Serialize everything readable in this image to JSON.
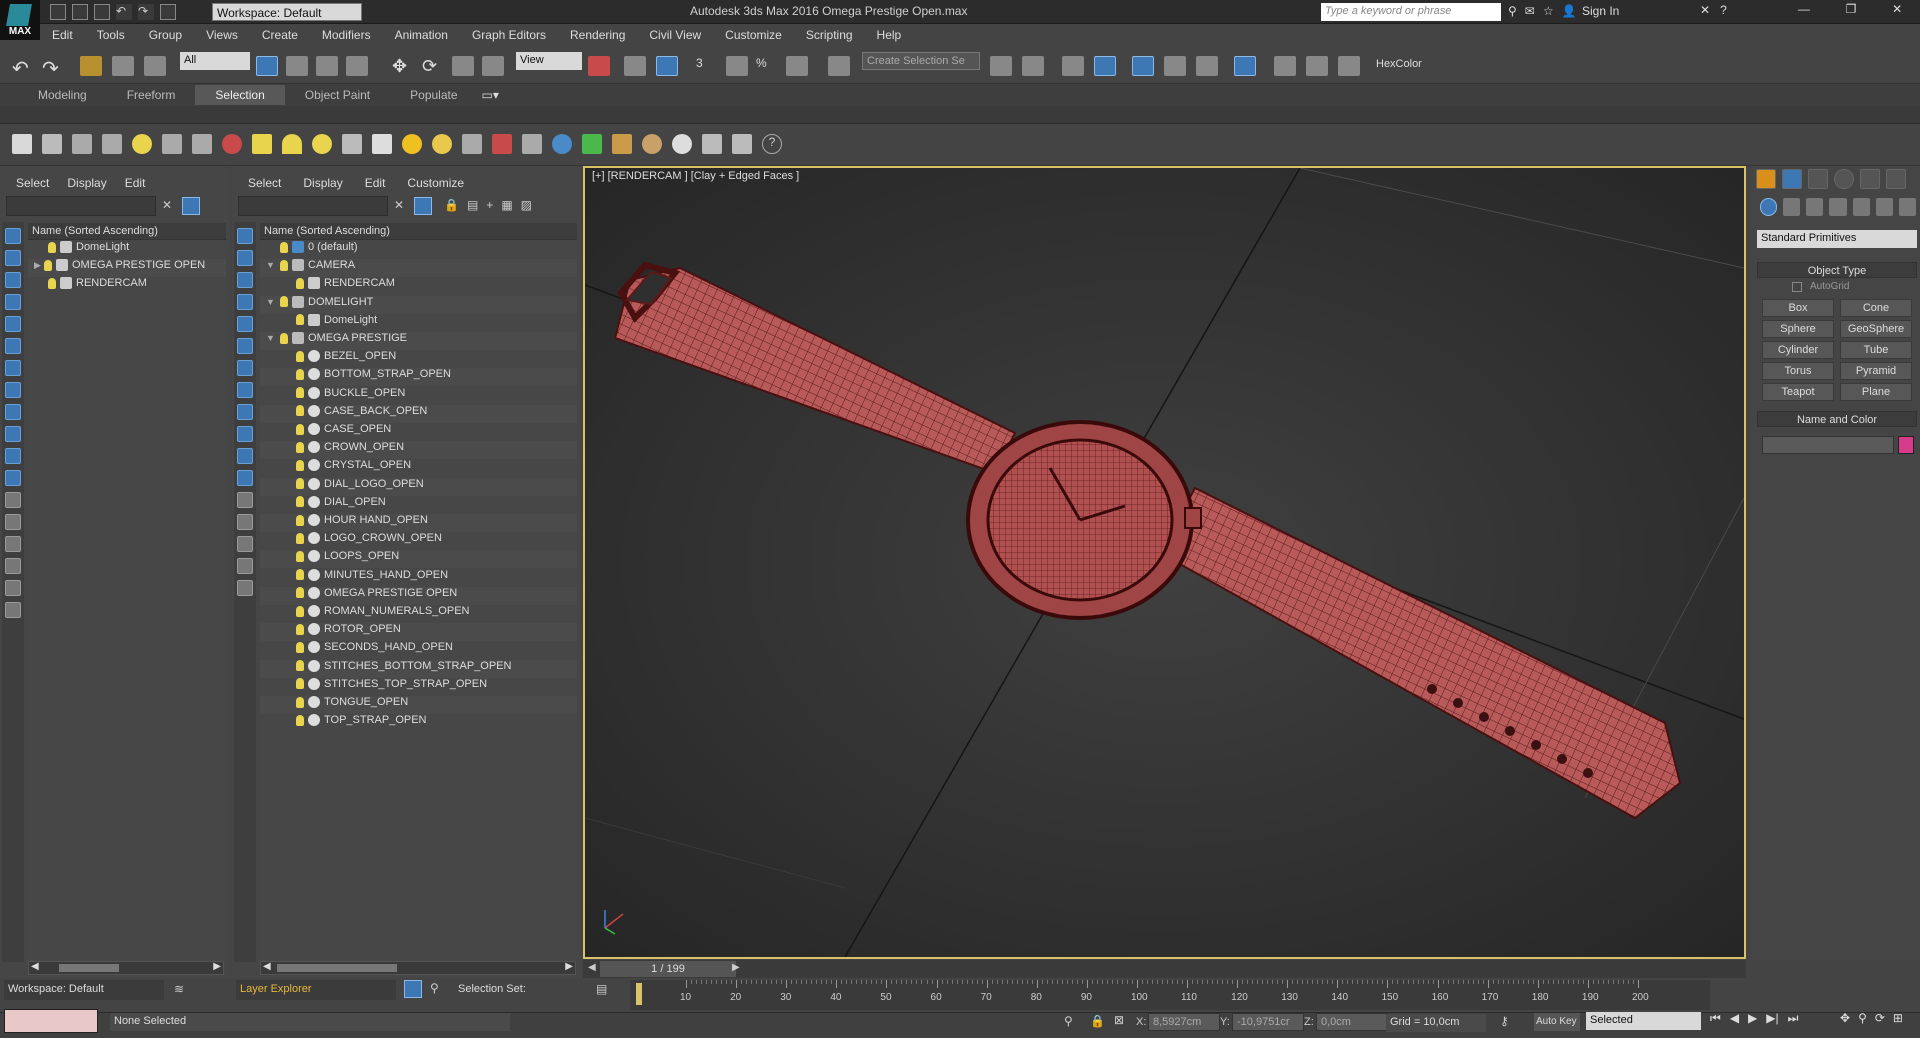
{
  "title_bar": {
    "workspace": "Workspace: Default",
    "app_title": "Autodesk 3ds Max 2016    Omega Prestige Open.max",
    "search_placeholder": "Type a keyword or phrase",
    "sign_in": "Sign In",
    "logo_text": "MAX"
  },
  "menu": [
    "Edit",
    "Tools",
    "Group",
    "Views",
    "Create",
    "Modifiers",
    "Animation",
    "Graph Editors",
    "Rendering",
    "Civil View",
    "Customize",
    "Scripting",
    "Help"
  ],
  "toolbar": {
    "filter_select": "All",
    "ref_coord": "View",
    "selection_set": "Create Selection Se",
    "hexcolor": "HexColor"
  },
  "ribbon_tabs": [
    "Modeling",
    "Freeform",
    "Selection",
    "Object Paint",
    "Populate"
  ],
  "ribbon_active": "Selection",
  "scene_explorer_left": {
    "menu": [
      "Select",
      "Display",
      "Edit"
    ],
    "header": "Name (Sorted Ascending)",
    "rows": [
      "DomeLight",
      "OMEGA PRESTIGE OPEN",
      "RENDERCAM"
    ]
  },
  "layer_explorer": {
    "menu": [
      "Select",
      "Display",
      "Edit",
      "Customize"
    ],
    "header": "Name (Sorted Ascending)",
    "rows": [
      {
        "label": "0 (default)",
        "indent": 1,
        "kind": "layer"
      },
      {
        "label": "CAMERA",
        "indent": 1,
        "kind": "layer"
      },
      {
        "label": "RENDERCAM",
        "indent": 2,
        "kind": "cam"
      },
      {
        "label": "DOMELIGHT",
        "indent": 1,
        "kind": "layer"
      },
      {
        "label": "DomeLight",
        "indent": 2,
        "kind": "light"
      },
      {
        "label": "OMEGA PRESTIGE",
        "indent": 1,
        "kind": "layer"
      },
      {
        "label": "BEZEL_OPEN",
        "indent": 2,
        "kind": "obj"
      },
      {
        "label": "BOTTOM_STRAP_OPEN",
        "indent": 2,
        "kind": "obj"
      },
      {
        "label": "BUCKLE_OPEN",
        "indent": 2,
        "kind": "obj"
      },
      {
        "label": "CASE_BACK_OPEN",
        "indent": 2,
        "kind": "obj"
      },
      {
        "label": "CASE_OPEN",
        "indent": 2,
        "kind": "obj"
      },
      {
        "label": "CROWN_OPEN",
        "indent": 2,
        "kind": "obj"
      },
      {
        "label": "CRYSTAL_OPEN",
        "indent": 2,
        "kind": "obj"
      },
      {
        "label": "DIAL_LOGO_OPEN",
        "indent": 2,
        "kind": "obj"
      },
      {
        "label": "DIAL_OPEN",
        "indent": 2,
        "kind": "obj"
      },
      {
        "label": "HOUR HAND_OPEN",
        "indent": 2,
        "kind": "obj"
      },
      {
        "label": "LOGO_CROWN_OPEN",
        "indent": 2,
        "kind": "obj"
      },
      {
        "label": "LOOPS_OPEN",
        "indent": 2,
        "kind": "obj"
      },
      {
        "label": "MINUTES_HAND_OPEN",
        "indent": 2,
        "kind": "obj"
      },
      {
        "label": "OMEGA PRESTIGE OPEN",
        "indent": 2,
        "kind": "obj"
      },
      {
        "label": "ROMAN_NUMERALS_OPEN",
        "indent": 2,
        "kind": "obj"
      },
      {
        "label": "ROTOR_OPEN",
        "indent": 2,
        "kind": "obj"
      },
      {
        "label": "SECONDS_HAND_OPEN",
        "indent": 2,
        "kind": "obj"
      },
      {
        "label": "STITCHES_BOTTOM_STRAP_OPEN",
        "indent": 2,
        "kind": "obj"
      },
      {
        "label": "STITCHES_TOP_STRAP_OPEN",
        "indent": 2,
        "kind": "obj"
      },
      {
        "label": "TONGUE_OPEN",
        "indent": 2,
        "kind": "obj"
      },
      {
        "label": "TOP_STRAP_OPEN",
        "indent": 2,
        "kind": "obj"
      }
    ]
  },
  "viewport": {
    "label": "[+] [RENDERCAM ] [Clay + Edged Faces ]"
  },
  "command_panel": {
    "category": "Standard Primitives",
    "object_type_header": "Object Type",
    "autogrid": "AutoGrid",
    "buttons": [
      "Box",
      "Cone",
      "Sphere",
      "GeoSphere",
      "Cylinder",
      "Tube",
      "Torus",
      "Pyramid",
      "Teapot",
      "Plane"
    ],
    "name_color_header": "Name and Color",
    "object_color": "#d83a8a"
  },
  "timeline": {
    "frame": "1 / 199",
    "ticks": [
      "10",
      "20",
      "30",
      "40",
      "50",
      "60",
      "70",
      "80",
      "90",
      "100",
      "110",
      "120",
      "130",
      "140",
      "150",
      "160",
      "170",
      "180",
      "190",
      "200"
    ]
  },
  "bottom": {
    "workspace": "Workspace: Default",
    "explorer": "Layer Explorer",
    "selection_set": "Selection Set:",
    "status": "None Selected",
    "x": "8,5927cm",
    "y": "-10,9751cr",
    "z": "0,0cm",
    "grid": "Grid = 10,0cm",
    "auto_key": "Auto Key",
    "key_mode": "Selected"
  },
  "colors": {
    "wire": "#8a3030",
    "viewport_bg": "#2f2f2f",
    "accent": "#3d78b5"
  }
}
